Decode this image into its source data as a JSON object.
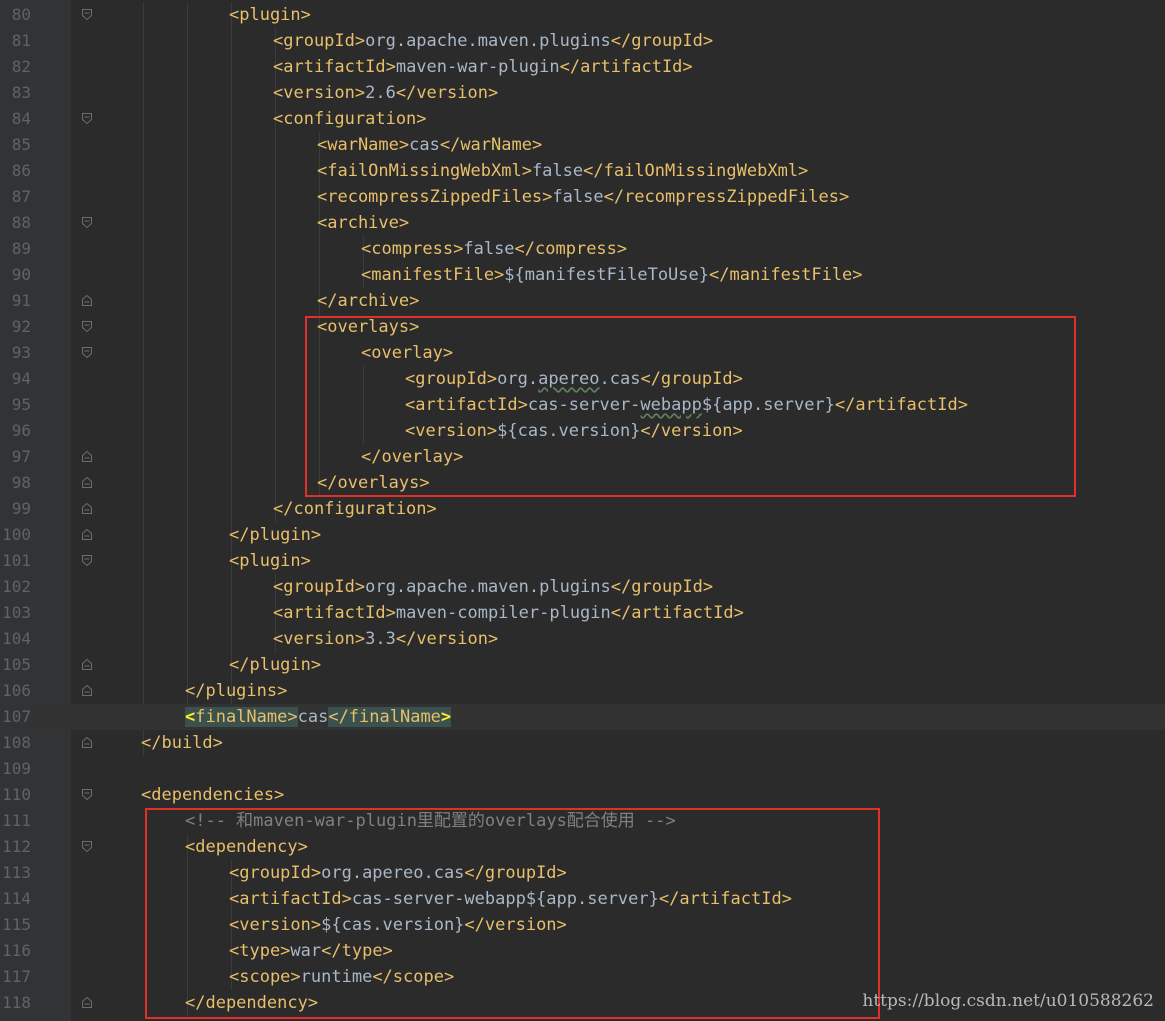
{
  "editor": {
    "lines": [
      {
        "num": "80",
        "fold": "open",
        "segs": [
          [
            "tag",
            "<plugin>"
          ]
        ]
      },
      {
        "num": "81",
        "fold": "",
        "segs": [
          [
            "tag",
            "<groupId>"
          ],
          [
            "txt",
            "org.apache.maven.plugins"
          ],
          [
            "tag",
            "</groupId>"
          ]
        ]
      },
      {
        "num": "82",
        "fold": "",
        "segs": [
          [
            "tag",
            "<artifactId>"
          ],
          [
            "txt",
            "maven-war-plugin"
          ],
          [
            "tag",
            "</artifactId>"
          ]
        ]
      },
      {
        "num": "83",
        "fold": "",
        "segs": [
          [
            "tag",
            "<version>"
          ],
          [
            "txt",
            "2.6"
          ],
          [
            "tag",
            "</version>"
          ]
        ]
      },
      {
        "num": "84",
        "fold": "open",
        "segs": [
          [
            "tag",
            "<configuration>"
          ]
        ]
      },
      {
        "num": "85",
        "fold": "",
        "segs": [
          [
            "tag",
            "<warName>"
          ],
          [
            "txt",
            "cas"
          ],
          [
            "tag",
            "</warName>"
          ]
        ]
      },
      {
        "num": "86",
        "fold": "",
        "segs": [
          [
            "tag",
            "<failOnMissingWebXml>"
          ],
          [
            "txt",
            "false"
          ],
          [
            "tag",
            "</failOnMissingWebXml>"
          ]
        ]
      },
      {
        "num": "87",
        "fold": "",
        "segs": [
          [
            "tag",
            "<recompressZippedFiles>"
          ],
          [
            "txt",
            "false"
          ],
          [
            "tag",
            "</recompressZippedFiles>"
          ]
        ]
      },
      {
        "num": "88",
        "fold": "open",
        "segs": [
          [
            "tag",
            "<archive>"
          ]
        ]
      },
      {
        "num": "89",
        "fold": "",
        "segs": [
          [
            "tag",
            "<compress>"
          ],
          [
            "txt",
            "false"
          ],
          [
            "tag",
            "</compress>"
          ]
        ]
      },
      {
        "num": "90",
        "fold": "",
        "segs": [
          [
            "tag",
            "<manifestFile>"
          ],
          [
            "txt",
            "${manifestFileToUse}"
          ],
          [
            "tag",
            "</manifestFile>"
          ]
        ]
      },
      {
        "num": "91",
        "fold": "close",
        "segs": [
          [
            "tag",
            "</archive>"
          ]
        ]
      },
      {
        "num": "92",
        "fold": "open",
        "segs": [
          [
            "tag",
            "<overlays>"
          ]
        ]
      },
      {
        "num": "93",
        "fold": "open",
        "segs": [
          [
            "tag",
            "<overlay>"
          ]
        ]
      },
      {
        "num": "94",
        "fold": "",
        "segs": [
          [
            "tag",
            "<groupId>"
          ],
          [
            "txt",
            "org."
          ],
          [
            "txt-wavy",
            "apereo"
          ],
          [
            "txt",
            ".cas"
          ],
          [
            "tag",
            "</groupId>"
          ]
        ]
      },
      {
        "num": "95",
        "fold": "",
        "segs": [
          [
            "tag",
            "<artifactId>"
          ],
          [
            "txt",
            "cas-server-"
          ],
          [
            "txt-wavy",
            "webapp"
          ],
          [
            "txt",
            "${app.server}"
          ],
          [
            "tag",
            "</artifactId>"
          ]
        ]
      },
      {
        "num": "96",
        "fold": "",
        "segs": [
          [
            "tag",
            "<version>"
          ],
          [
            "txt",
            "${cas.version}"
          ],
          [
            "tag",
            "</version>"
          ]
        ]
      },
      {
        "num": "97",
        "fold": "close",
        "segs": [
          [
            "tag",
            "</overlay>"
          ]
        ]
      },
      {
        "num": "98",
        "fold": "close",
        "segs": [
          [
            "tag",
            "</overlays>"
          ]
        ]
      },
      {
        "num": "99",
        "fold": "close",
        "segs": [
          [
            "tag",
            "</configuration>"
          ]
        ]
      },
      {
        "num": "100",
        "fold": "close",
        "segs": [
          [
            "tag",
            "</plugin>"
          ]
        ]
      },
      {
        "num": "101",
        "fold": "open",
        "segs": [
          [
            "tag",
            "<plugin>"
          ]
        ]
      },
      {
        "num": "102",
        "fold": "",
        "segs": [
          [
            "tag",
            "<groupId>"
          ],
          [
            "txt",
            "org.apache.maven.plugins"
          ],
          [
            "tag",
            "</groupId>"
          ]
        ]
      },
      {
        "num": "103",
        "fold": "",
        "segs": [
          [
            "tag",
            "<artifactId>"
          ],
          [
            "txt",
            "maven-compiler-plugin"
          ],
          [
            "tag",
            "</artifactId>"
          ]
        ]
      },
      {
        "num": "104",
        "fold": "",
        "segs": [
          [
            "tag",
            "<version>"
          ],
          [
            "txt",
            "3.3"
          ],
          [
            "tag",
            "</version>"
          ]
        ]
      },
      {
        "num": "105",
        "fold": "close",
        "segs": [
          [
            "tag",
            "</plugin>"
          ]
        ]
      },
      {
        "num": "106",
        "fold": "close",
        "segs": [
          [
            "tag",
            "</plugins>"
          ]
        ]
      },
      {
        "num": "107",
        "fold": "",
        "segs": [
          [
            "bracket",
            "<"
          ],
          [
            "match",
            "finalName>"
          ],
          [
            "txt",
            "cas"
          ],
          [
            "match",
            "</finalName"
          ],
          [
            "bracket",
            ">"
          ]
        ]
      },
      {
        "num": "108",
        "fold": "close",
        "segs": [
          [
            "tag",
            "</build>"
          ]
        ]
      },
      {
        "num": "109",
        "fold": "",
        "segs": []
      },
      {
        "num": "110",
        "fold": "open",
        "segs": [
          [
            "tag",
            "<dependencies>"
          ]
        ]
      },
      {
        "num": "111",
        "fold": "",
        "segs": [
          [
            "cmt",
            "<!-- 和maven-war-plugin里配置的overlays配合使用 -->"
          ]
        ]
      },
      {
        "num": "112",
        "fold": "open",
        "segs": [
          [
            "tag",
            "<dependency>"
          ]
        ]
      },
      {
        "num": "113",
        "fold": "",
        "segs": [
          [
            "tag",
            "<groupId>"
          ],
          [
            "txt",
            "org.apereo.cas"
          ],
          [
            "tag",
            "</groupId>"
          ]
        ]
      },
      {
        "num": "114",
        "fold": "",
        "segs": [
          [
            "tag",
            "<artifactId>"
          ],
          [
            "txt",
            "cas-server-webapp${app.server}"
          ],
          [
            "tag",
            "</artifactId>"
          ]
        ]
      },
      {
        "num": "115",
        "fold": "",
        "segs": [
          [
            "tag",
            "<version>"
          ],
          [
            "txt",
            "${cas.version}"
          ],
          [
            "tag",
            "</version>"
          ]
        ]
      },
      {
        "num": "116",
        "fold": "",
        "segs": [
          [
            "tag",
            "<type>"
          ],
          [
            "txt",
            "war"
          ],
          [
            "tag",
            "</type>"
          ]
        ]
      },
      {
        "num": "117",
        "fold": "",
        "segs": [
          [
            "tag",
            "<scope>"
          ],
          [
            "txt",
            "runtime"
          ],
          [
            "tag",
            "</scope>"
          ]
        ]
      },
      {
        "num": "118",
        "fold": "close",
        "segs": [
          [
            "tag",
            "</dependency>"
          ]
        ]
      }
    ],
    "current_line": "107"
  },
  "watermark": {
    "text": "https://blog.csdn.net/u010588262"
  },
  "colors": {
    "background": "#2b2b2b",
    "gutter": "#313335",
    "tag": "#e8bf6a",
    "text": "#a9b7c6",
    "comment": "#808080",
    "annotation_box": "#e0302a"
  }
}
